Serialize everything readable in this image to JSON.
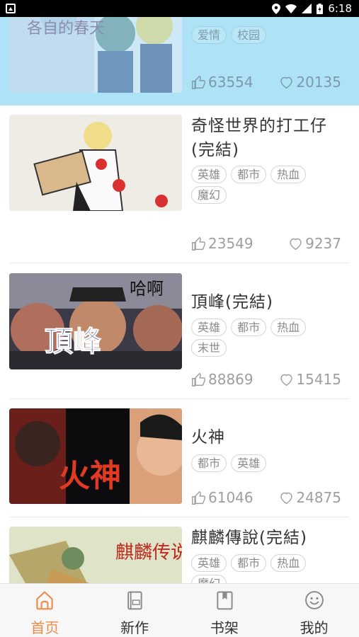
{
  "status_bar": {
    "time": "6:18"
  },
  "feed": [
    {
      "title": "",
      "tags": [
        "爱情",
        "校园"
      ],
      "likes": "63554",
      "favorites": "20135",
      "highlight": true,
      "cover_text": "各自的春天"
    },
    {
      "title": "奇怪世界的打工仔(完結)",
      "tags": [
        "英雄",
        "都市",
        "热血",
        "魔幻"
      ],
      "likes": "23549",
      "favorites": "9237"
    },
    {
      "title": "頂峰(完結)",
      "tags": [
        "英雄",
        "都市",
        "热血",
        "末世"
      ],
      "likes": "88869",
      "favorites": "15415",
      "cover_text": "哈啊",
      "cover_title": "頂峰"
    },
    {
      "title": "火神",
      "tags": [
        "都市",
        "英雄"
      ],
      "likes": "61046",
      "favorites": "24875",
      "cover_title": "火神"
    },
    {
      "title": "麒麟傳說(完結)",
      "tags": [
        "英雄",
        "都市",
        "热血",
        "魔幻"
      ],
      "likes": "",
      "favorites": "",
      "cover_title": "麒麟传说"
    }
  ],
  "tabbar": {
    "items": [
      {
        "label": "首页",
        "icon": "home-icon",
        "active": true
      },
      {
        "label": "新作",
        "icon": "new-book-icon",
        "active": false
      },
      {
        "label": "书架",
        "icon": "bookshelf-icon",
        "active": false
      },
      {
        "label": "我的",
        "icon": "smiley-icon",
        "active": false
      }
    ],
    "active_color": "#f08a4b"
  }
}
